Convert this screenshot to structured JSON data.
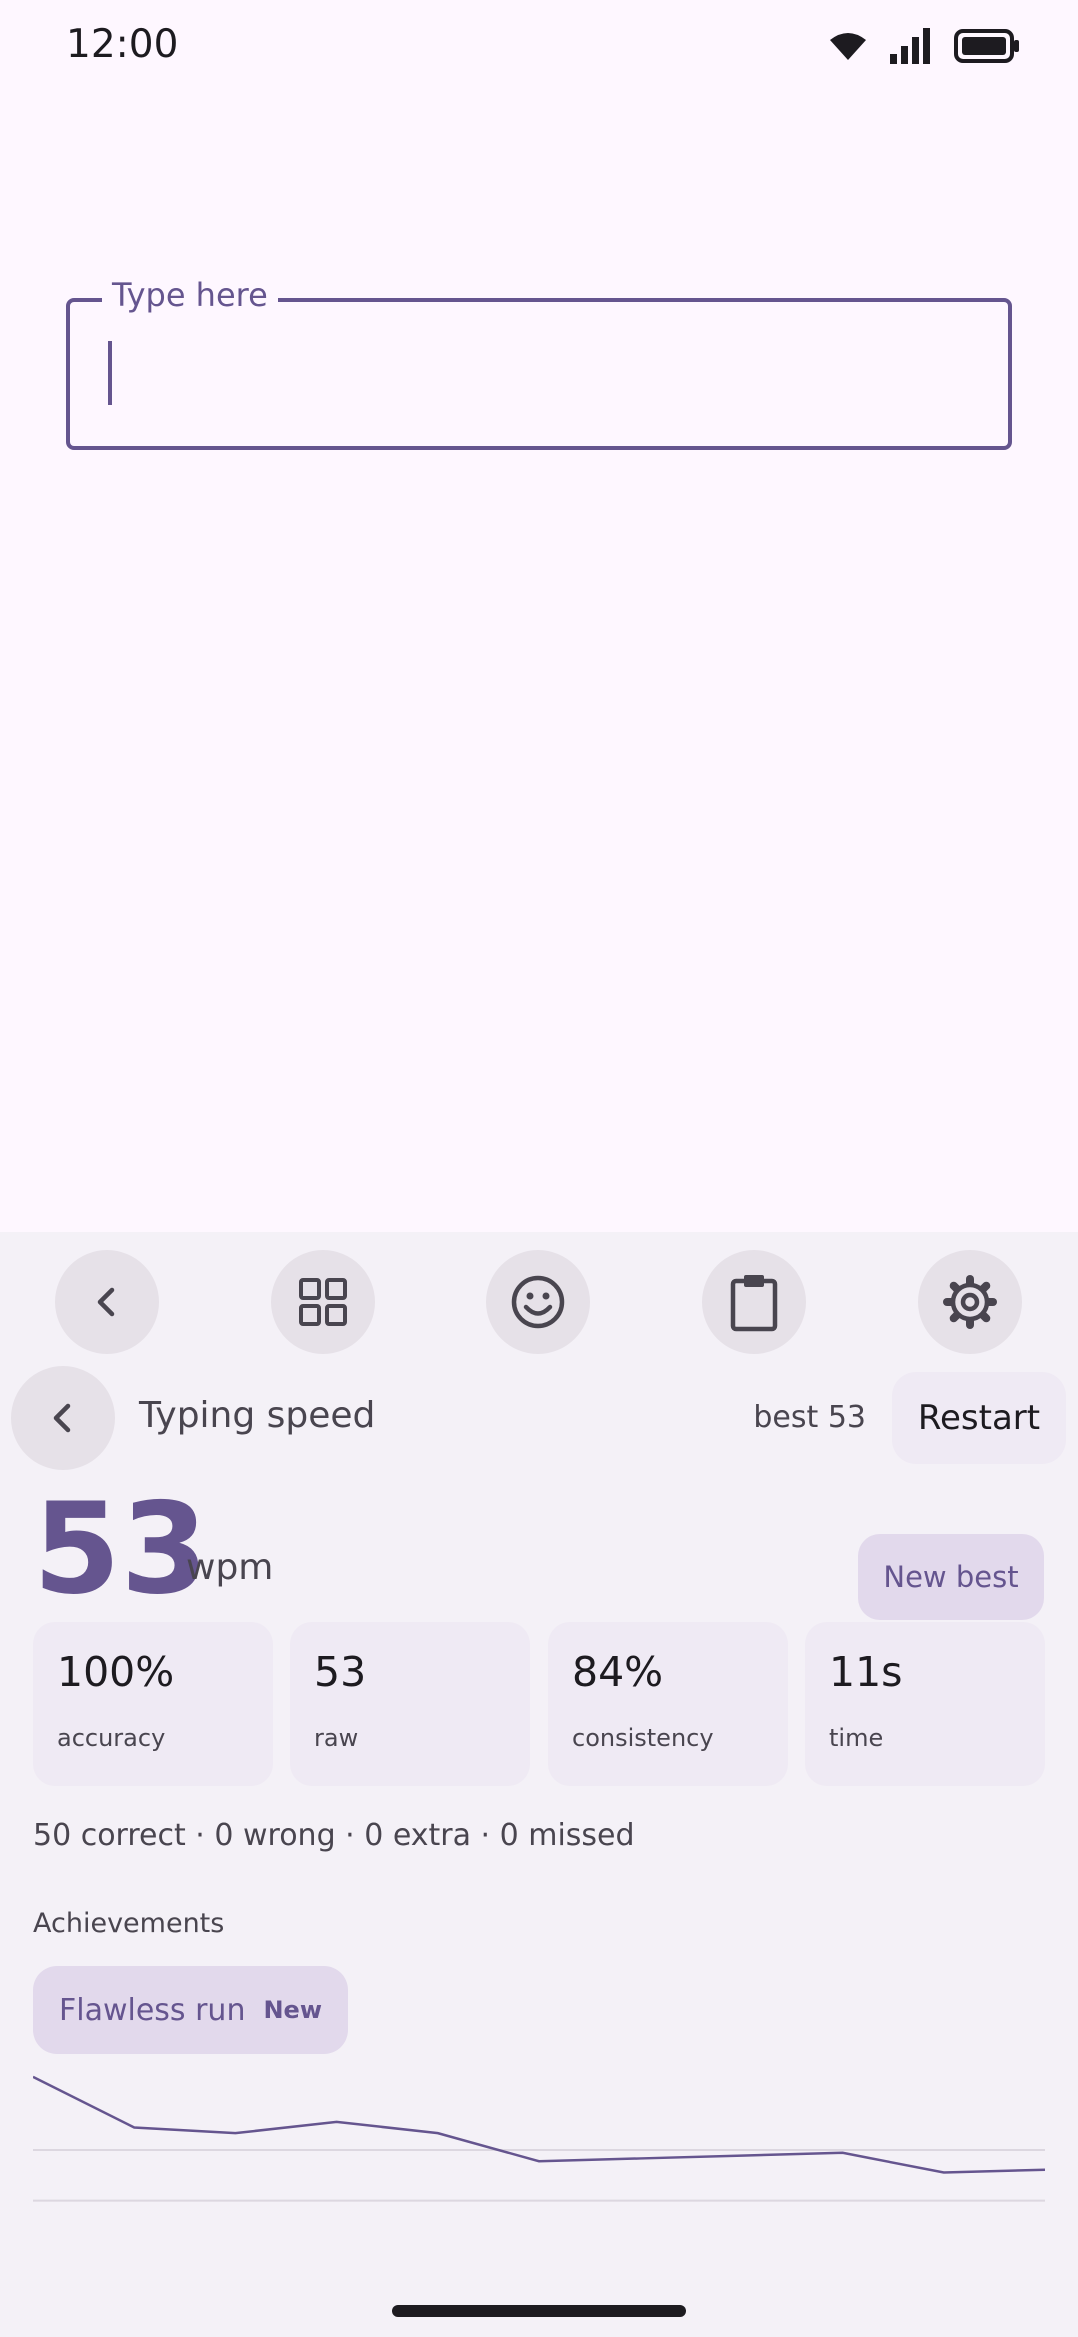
{
  "status_bar": {
    "time": "12:00",
    "icons": [
      "wifi-icon",
      "signal-icon",
      "battery-icon"
    ]
  },
  "input": {
    "label": "Type here",
    "value": ""
  },
  "toolbar": {
    "buttons": [
      "chevron-left-icon",
      "grid-icon",
      "emoji-icon",
      "clipboard-icon",
      "gear-icon"
    ]
  },
  "panel": {
    "title": "Typing speed",
    "best": "best 53",
    "restart_label": "Restart"
  },
  "result": {
    "wpm": "53",
    "unit": "wpm",
    "new_best_label": "New best"
  },
  "stats": [
    {
      "value": "100%",
      "label": "accuracy"
    },
    {
      "value": "53",
      "label": "raw"
    },
    {
      "value": "84%",
      "label": "consistency"
    },
    {
      "value": "11s",
      "label": "time"
    }
  ],
  "summary": "50 correct · 0 wrong · 0 extra · 0 missed",
  "achievements": {
    "heading": "Achievements",
    "items": [
      {
        "name": "Flawless run",
        "badge": "New"
      }
    ]
  },
  "colors": {
    "accent": "#65558F",
    "background": "#FEF7FF",
    "panel": "#F4F1F7"
  },
  "chart_data": {
    "type": "line",
    "x": [
      0,
      1,
      2,
      3,
      4,
      5,
      6,
      7,
      8,
      9,
      10
    ],
    "values": [
      65,
      56,
      55,
      57,
      55,
      50,
      50.5,
      51,
      51.5,
      48,
      48.5
    ],
    "ylim": [
      36,
      68
    ],
    "gridlines": [
      52,
      43,
      34
    ],
    "grid": true
  }
}
